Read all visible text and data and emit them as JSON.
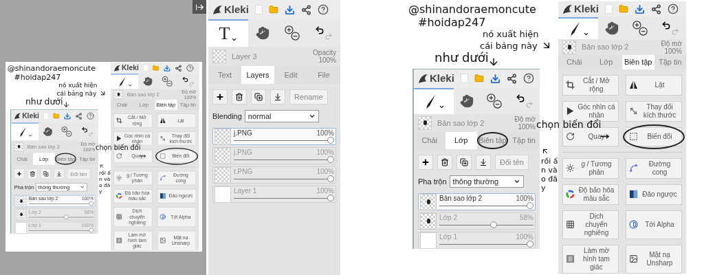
{
  "main_panel": {
    "app_name": "Kleki",
    "tool": {
      "kind": "text",
      "label": "T"
    },
    "layer_info": {
      "thumbnail": {
        "kind": "checker"
      },
      "name": "Layer 3",
      "opacity_label": "Opacity",
      "opacity": "100%"
    },
    "tabs": [
      {
        "label": "Text",
        "selected": false,
        "circled": false
      },
      {
        "label": "Layers",
        "selected": true,
        "circled": false
      },
      {
        "label": "Edit",
        "selected": false,
        "circled": false
      },
      {
        "label": "File",
        "selected": false,
        "circled": false
      }
    ],
    "rename_button": "Rename",
    "blending": {
      "label": "Blending",
      "value": "normal"
    },
    "layers": [
      {
        "name": "j.PNG",
        "opacity": "100%",
        "level": 1,
        "selected": true,
        "thumbnail": {
          "kind": "checker"
        }
      },
      {
        "name": "j.PNG",
        "opacity": "100%",
        "level": 1,
        "selected": false,
        "thumbnail": {
          "kind": "checker"
        }
      },
      {
        "name": "t.PNG",
        "opacity": "100%",
        "level": 1,
        "selected": false,
        "thumbnail": {
          "kind": "checker"
        }
      },
      {
        "name": "Layer 1",
        "opacity": "100%",
        "level": 1,
        "selected": false,
        "thumbnail": {
          "kind": "white"
        }
      }
    ]
  },
  "collages": [
    {
      "signature": [
        "@shinandoraemoncute",
        "#hoidap247"
      ],
      "note_appears": [
        "nó xuất hiện",
        "cái bảng này"
      ],
      "note_below": "như dưới",
      "note_choose": "chọn biến đổi",
      "note_tap": "rồi ấn vào đây",
      "layers_panel": {
        "app_name": "Kleki",
        "tool": {
          "kind": "brush"
        },
        "layer_info": {
          "thumbnail": {
            "kind": "figure"
          },
          "name": "Bản sao lớp 2",
          "opacity_label": "Độ mờ",
          "opacity": "100%"
        },
        "tabs": [
          {
            "label": "Chải",
            "selected": false,
            "circled": false
          },
          {
            "label": "Lớp",
            "selected": true,
            "circled": false
          },
          {
            "label": "Biên tập",
            "selected": false,
            "circled": true
          },
          {
            "label": "Tập tin",
            "selected": false,
            "circled": false
          }
        ],
        "rename_button": "Đổi tên",
        "blending": {
          "label": "Pha trộn",
          "value": "thông thường"
        },
        "layers": [
          {
            "name": "Bản sao lớp 2",
            "opacity": "100%",
            "level": 1,
            "selected": true,
            "thumbnail": {
              "kind": "figure"
            }
          },
          {
            "name": "Lớp 2",
            "opacity": "58%",
            "level": 0.58,
            "selected": false,
            "thumbnail": {
              "kind": "figure"
            }
          },
          {
            "name": "Lớp 1",
            "opacity": "100%",
            "level": 1,
            "selected": false,
            "thumbnail": {
              "kind": "white"
            }
          }
        ]
      },
      "edit_panel": {
        "app_name": "Kleki",
        "tool": {
          "kind": "brush"
        },
        "layer_info": {
          "thumbnail": {
            "kind": "figure"
          },
          "name": "Bản sao lớp 2",
          "opacity_label": "Độ mờ",
          "opacity": "100%"
        },
        "tabs": [
          {
            "label": "Chải",
            "selected": false,
            "circled": false
          },
          {
            "label": "Lớp",
            "selected": false,
            "circled": false
          },
          {
            "label": "Biên tập",
            "selected": true,
            "circled": false
          },
          {
            "label": "Tập tin",
            "selected": false,
            "circled": false
          }
        ],
        "edit_groups": [
          [
            {
              "label": "Cắt / Mở rộng",
              "kind": "crop",
              "circled": false
            },
            {
              "label": "Lật",
              "kind": "flip",
              "circled": false
            },
            {
              "label": "Góc nhìn cá nhân",
              "kind": "perspective",
              "circled": false
            },
            {
              "label": "Thay đổi kích thước",
              "kind": "resize",
              "circled": false
            },
            {
              "label": "Quay",
              "kind": "rotate",
              "circled": false
            },
            {
              "label": "Biến đổi",
              "kind": "transform",
              "circled": true
            }
          ],
          [
            {
              "label": "g / Tương phản",
              "kind": "brightness",
              "circled": false
            },
            {
              "label": "Đường cong",
              "kind": "curves",
              "circled": false
            },
            {
              "label": "Độ bão hòa màu sắc",
              "kind": "hue",
              "circled": false
            },
            {
              "label": "Đảo ngược",
              "kind": "invert",
              "circled": false
            },
            {
              "label": "Dịch chuyển nghiêng",
              "kind": "tiltshift",
              "circled": false
            },
            {
              "label": "Tới Alpha",
              "kind": "alpha",
              "circled": false
            },
            {
              "label": "Làm mờ hình tam giác",
              "kind": "blur",
              "circled": false
            },
            {
              "label": "Mặt nạ Unsharp",
              "kind": "unsharp",
              "circled": false
            }
          ]
        ]
      }
    },
    {
      "signature": [
        "@shinandoraemoncute",
        "#hoidap247"
      ],
      "note_appears": [
        "nó xuất hiện",
        "cái bảng này"
      ],
      "note_below": "như dưới",
      "note_choose": "chọn biến đổi",
      "note_tap": "rồi ấn vào đây",
      "layers_panel": {
        "app_name": "Kleki",
        "tool": {
          "kind": "brush"
        },
        "layer_info": {
          "thumbnail": {
            "kind": "figure"
          },
          "name": "Bản sao lớp 2",
          "opacity_label": "Độ mờ",
          "opacity": "100%"
        },
        "tabs": [
          {
            "label": "Chải",
            "selected": false,
            "circled": false
          },
          {
            "label": "Lớp",
            "selected": true,
            "circled": false
          },
          {
            "label": "Biên tập",
            "selected": false,
            "circled": true
          },
          {
            "label": "Tập tin",
            "selected": false,
            "circled": false
          }
        ],
        "rename_button": "Đổi tên",
        "blending": {
          "label": "Pha trộn",
          "value": "thông thường"
        },
        "layers": [
          {
            "name": "Bản sao lớp 2",
            "opacity": "100%",
            "level": 1,
            "selected": true,
            "thumbnail": {
              "kind": "figure"
            }
          },
          {
            "name": "Lớp 2",
            "opacity": "58%",
            "level": 0.58,
            "selected": false,
            "thumbnail": {
              "kind": "figure"
            }
          },
          {
            "name": "Lớp 1",
            "opacity": "100%",
            "level": 1,
            "selected": false,
            "thumbnail": {
              "kind": "white"
            }
          }
        ]
      },
      "edit_panel": {
        "app_name": "Kleki",
        "tool": {
          "kind": "brush"
        },
        "layer_info": {
          "thumbnail": {
            "kind": "figure"
          },
          "name": "Bản sao lớp 2",
          "opacity_label": "Độ mờ",
          "opacity": "100%"
        },
        "tabs": [
          {
            "label": "Chải",
            "selected": false,
            "circled": false
          },
          {
            "label": "Lớp",
            "selected": false,
            "circled": false
          },
          {
            "label": "Biên tập",
            "selected": true,
            "circled": false
          },
          {
            "label": "Tập tin",
            "selected": false,
            "circled": false
          }
        ],
        "edit_groups": [
          [
            {
              "label": "Cắt / Mở rộng",
              "kind": "crop",
              "circled": false
            },
            {
              "label": "Lật",
              "kind": "flip",
              "circled": false
            },
            {
              "label": "Góc nhìn cá nhân",
              "kind": "perspective",
              "circled": false
            },
            {
              "label": "Thay đổi kích thước",
              "kind": "resize",
              "circled": false
            },
            {
              "label": "Quay",
              "kind": "rotate",
              "circled": false
            },
            {
              "label": "Biến đổi",
              "kind": "transform",
              "circled": true
            }
          ],
          [
            {
              "label": "g / Tương phản",
              "kind": "brightness",
              "circled": false
            },
            {
              "label": "Đường cong",
              "kind": "curves",
              "circled": false
            },
            {
              "label": "Độ bão hòa màu sắc",
              "kind": "hue",
              "circled": false
            },
            {
              "label": "Đảo ngược",
              "kind": "invert",
              "circled": false
            },
            {
              "label": "Dịch chuyển nghiêng",
              "kind": "tiltshift",
              "circled": false
            },
            {
              "label": "Tới Alpha",
              "kind": "alpha",
              "circled": false
            },
            {
              "label": "Làm mờ hình tam giác",
              "kind": "blur",
              "circled": false
            },
            {
              "label": "Mặt nạ Unsharp",
              "kind": "unsharp",
              "circled": false
            }
          ]
        ]
      }
    }
  ]
}
